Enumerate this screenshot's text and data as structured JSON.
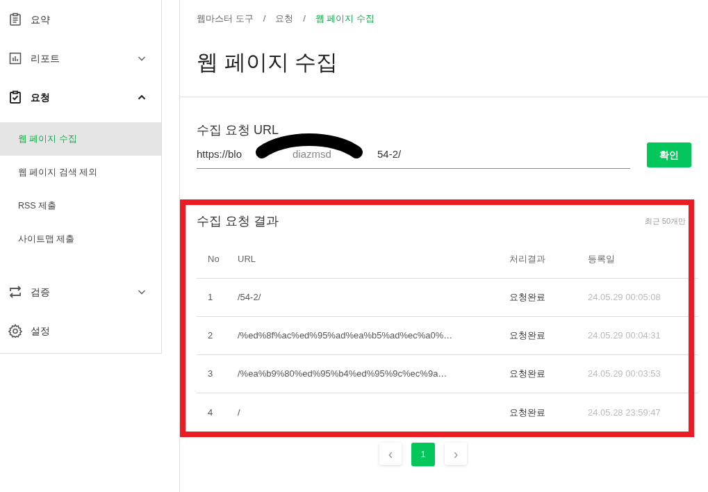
{
  "sidebar": {
    "items": [
      {
        "label": "요약",
        "expanded": false,
        "expandable": false
      },
      {
        "label": "리포트",
        "expanded": false,
        "expandable": true
      },
      {
        "label": "요청",
        "expanded": true,
        "expandable": true,
        "children": [
          {
            "label": "웹 페이지 수집",
            "selected": true
          },
          {
            "label": "웹 페이지 검색 제외",
            "selected": false
          },
          {
            "label": "RSS 제출",
            "selected": false
          },
          {
            "label": "사이트맵 제출",
            "selected": false
          }
        ]
      },
      {
        "label": "검증",
        "expanded": false,
        "expandable": true
      },
      {
        "label": "설정",
        "expanded": false,
        "expandable": false
      }
    ]
  },
  "breadcrumb": [
    {
      "label": "웹마스터 도구",
      "selected": false
    },
    {
      "label": "/",
      "selected": false
    },
    {
      "label": "요청",
      "selected": false
    },
    {
      "label": "/",
      "selected": false
    },
    {
      "label": "웹 페이지 수집",
      "selected": true
    }
  ],
  "page_title": "웹 페이지 수집",
  "url_input": {
    "label": "수집 요청 URL",
    "value_parts": [
      "https://blo",
      "diazmsd",
      "54-2/"
    ],
    "button": "확인"
  },
  "results": {
    "title": "수집 요청 결과",
    "note": "최근 50개만",
    "columns": [
      "No",
      "URL",
      "처리결과",
      "등록일"
    ],
    "rows": [
      [
        "1",
        "/54-2/",
        "요청완료",
        "24.05.29 00:05:08"
      ],
      [
        "2",
        "/%ed%8f%ac%ed%95%ad%ea%b5%ad%ec%a0%…",
        "요청완료",
        "24.05.29 00:04:31"
      ],
      [
        "3",
        "/%ea%b9%80%ed%95%b4%ed%95%9c%ec%9a…",
        "요청완료",
        "24.05.29 00:03:53"
      ],
      [
        "4",
        "/",
        "요청완료",
        "24.05.28 23:59:47"
      ]
    ]
  },
  "pagination": {
    "prev": "‹",
    "pages": [
      {
        "label": "1",
        "selected": true
      }
    ],
    "next": "›"
  }
}
